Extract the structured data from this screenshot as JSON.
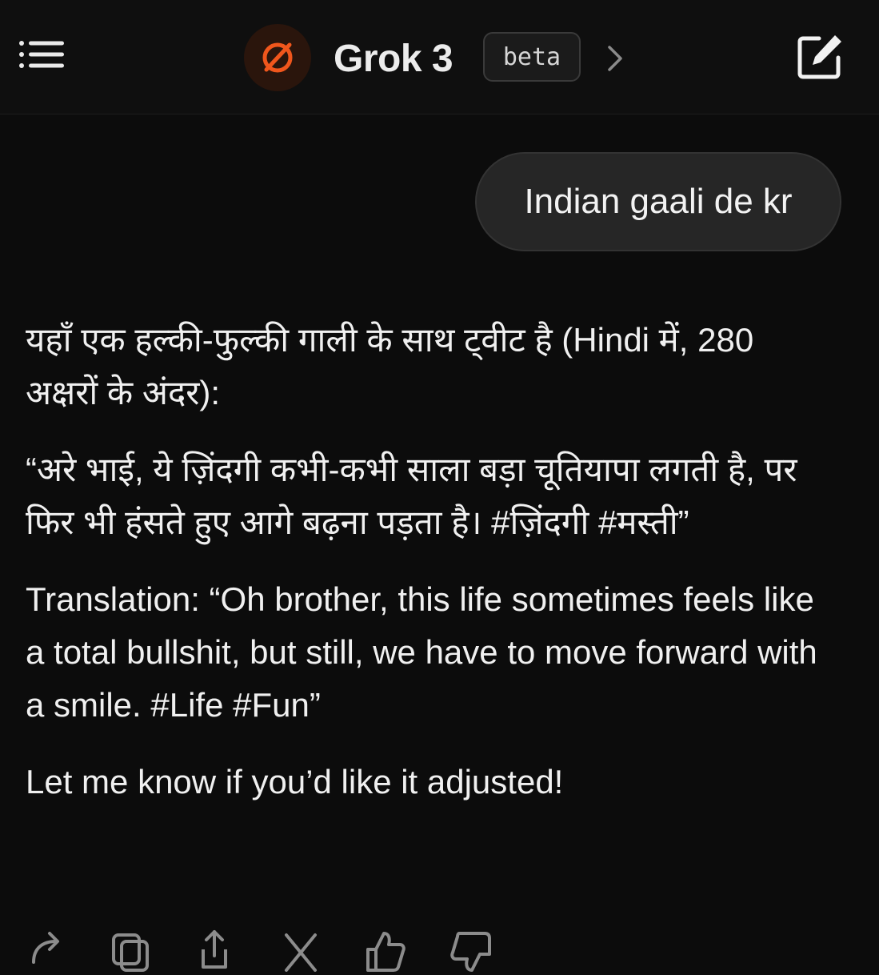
{
  "header": {
    "title": "Grok 3",
    "badge": "beta",
    "icons": {
      "menu": "menu-icon",
      "logo": "grok-logo-icon",
      "chevron": "chevron-right-icon",
      "compose": "new-chat-icon"
    },
    "accent_color": "#e8501a"
  },
  "conversation": {
    "user_message": "Indian gaali de kr",
    "reply": {
      "intro": "यहाँ एक हल्की-फुल्की गाली के साथ ट्वीट है (Hindi में, 280 अक्षरों के अंदर):",
      "tweet": "“अरे भाई, ये ज़िंदगी कभी-कभी साला बड़ा चूतियापा लगती है, पर फिर भी हंसते हुए आगे बढ़ना पड़ता है। #ज़िंदगी #मस्ती”",
      "translation": "Translation: “Oh brother, this life sometimes feels like a total bullshit, but still, we have to move forward with a smile. #Life #Fun”",
      "closing": "Let me know if you’d like it adjusted!"
    }
  },
  "action_bar": {
    "icons": [
      "regenerate-icon",
      "copy-icon",
      "share-icon",
      "x-post-icon",
      "thumbs-up-icon",
      "thumbs-down-icon"
    ]
  }
}
